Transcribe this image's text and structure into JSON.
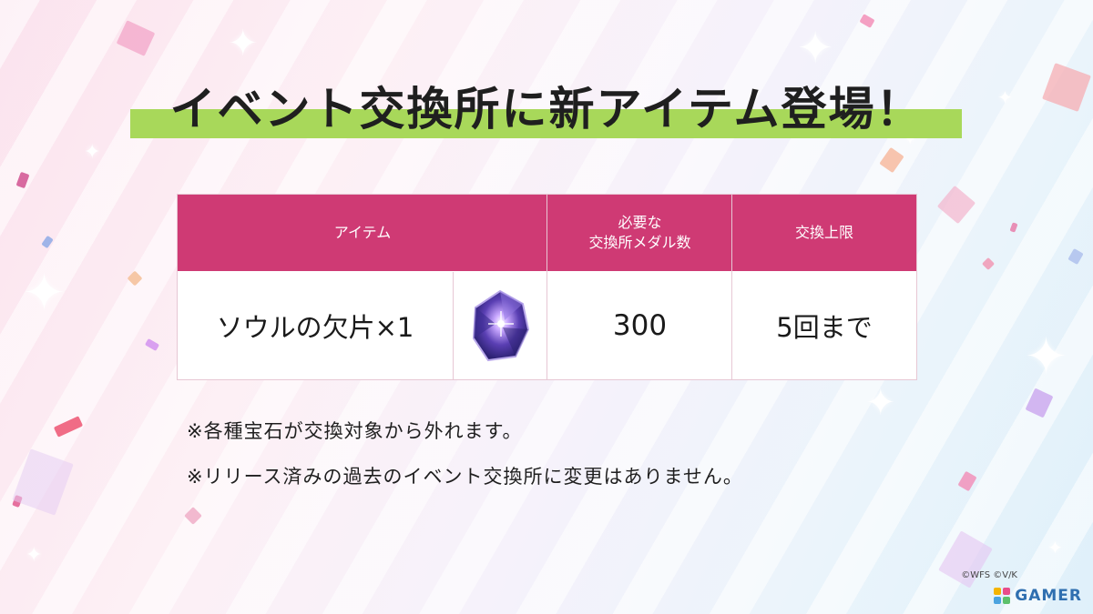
{
  "title": "イベント交換所に新アイテム登場！",
  "table": {
    "headers": {
      "item": "アイテム",
      "medals": "必要な\n交換所メダル数",
      "limit": "交換上限"
    },
    "row": {
      "item_name": "ソウルの欠片×1",
      "medals": "300",
      "limit": "5回まで",
      "item_icon": "soul-fragment-gem-icon"
    }
  },
  "notes": [
    "※各種宝石が交換対象から外れます。",
    "※リリース済みの過去のイベント交換所に変更はありません。"
  ],
  "copyright": "©WFS ©V/K",
  "brand": "GAMER",
  "colors": {
    "header_bg": "#cf3a74",
    "title_underline": "#a8d85a",
    "brand": "#2f6fb0"
  }
}
